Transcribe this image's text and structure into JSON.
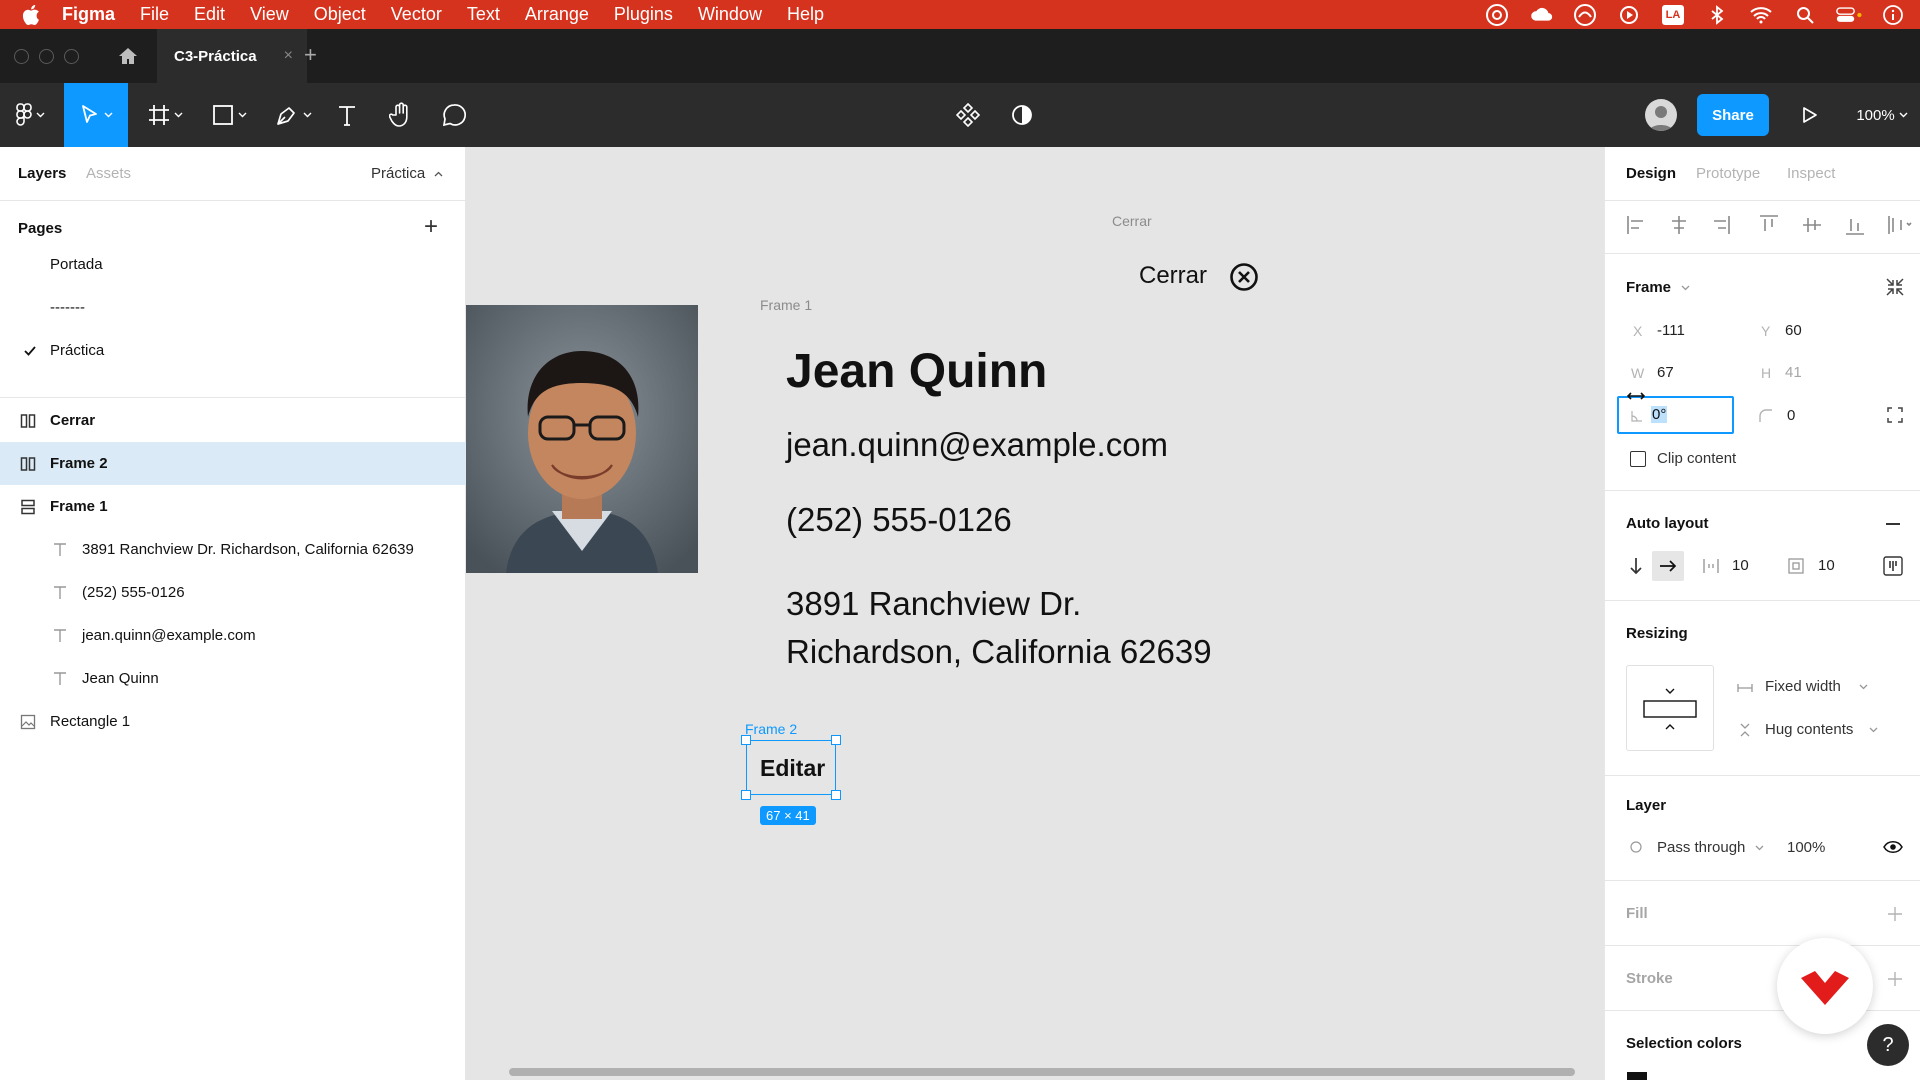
{
  "menubar": {
    "app": "Figma",
    "items": [
      "File",
      "Edit",
      "View",
      "Object",
      "Vector",
      "Text",
      "Arrange",
      "Plugins",
      "Window",
      "Help"
    ],
    "status_icons": [
      "creative-cloud-icon",
      "cloud-icon",
      "acrobat-icon",
      "play-circle-icon",
      "la-icon",
      "bluetooth-icon",
      "wifi-icon",
      "search-icon",
      "control-center-icon",
      "info-icon"
    ],
    "la_text": "LA"
  },
  "tabs": {
    "active": "C3-Práctica",
    "close": "×",
    "add": "+"
  },
  "toolbar": {
    "share_label": "Share",
    "zoom": "100%"
  },
  "left_panel": {
    "tab_layers": "Layers",
    "tab_assets": "Assets",
    "page_select": "Práctica",
    "pages_title": "Pages",
    "add_page": "+",
    "pages": [
      "Portada",
      "-------",
      "Práctica"
    ],
    "layers": [
      {
        "label": "Cerrar",
        "type": "frame-h",
        "indent": 0,
        "bold": true
      },
      {
        "label": "Frame 2",
        "type": "frame-h",
        "indent": 0,
        "bold": true,
        "selected": true
      },
      {
        "label": "Frame 1",
        "type": "frame-v",
        "indent": 0,
        "bold": true
      },
      {
        "label": "3891 Ranchview Dr. Richardson, California 62639",
        "type": "text",
        "indent": 1
      },
      {
        "label": "(252) 555-0126",
        "type": "text",
        "indent": 1
      },
      {
        "label": "jean.quinn@example.com",
        "type": "text",
        "indent": 1
      },
      {
        "label": "Jean Quinn",
        "type": "text",
        "indent": 1
      },
      {
        "label": "Rectangle 1",
        "type": "image",
        "indent": 0
      }
    ]
  },
  "canvas": {
    "cerrar_label_small": "Cerrar",
    "cerrar_text": "Cerrar",
    "frame1_label": "Frame 1",
    "name": "Jean Quinn",
    "email": "jean.quinn@example.com",
    "phone": "(252) 555-0126",
    "address_line1": "3891 Ranchview Dr.",
    "address_line2": "Richardson, California 62639",
    "frame2_label": "Frame 2",
    "button_text": "Editar",
    "size_badge": "67 × 41"
  },
  "right_panel": {
    "tab_design": "Design",
    "tab_prototype": "Prototype",
    "tab_inspect": "Inspect",
    "frame_title": "Frame",
    "x_label": "X",
    "x_value": "-111",
    "y_label": "Y",
    "y_value": "60",
    "w_label": "W",
    "w_value": "67",
    "h_label": "H",
    "h_value": "41",
    "rotation_value": "0°",
    "radius_value": "0",
    "clip_content": "Clip content",
    "auto_layout_title": "Auto layout",
    "spacing_value": "10",
    "padding_value": "10",
    "resizing_title": "Resizing",
    "resize_horizontal": "Fixed width",
    "resize_vertical": "Hug contents",
    "layer_title": "Layer",
    "blend_mode": "Pass through",
    "opacity": "100%",
    "fill_title": "Fill",
    "stroke_title": "Stroke",
    "selection_colors_title": "Selection colors",
    "help": "?"
  },
  "colors": {
    "menubar": "#d6331f",
    "accent": "#0d99ff",
    "toolbar": "#2c2c2c",
    "selection_row": "#daebf7",
    "canvas": "#e5e5e5"
  }
}
